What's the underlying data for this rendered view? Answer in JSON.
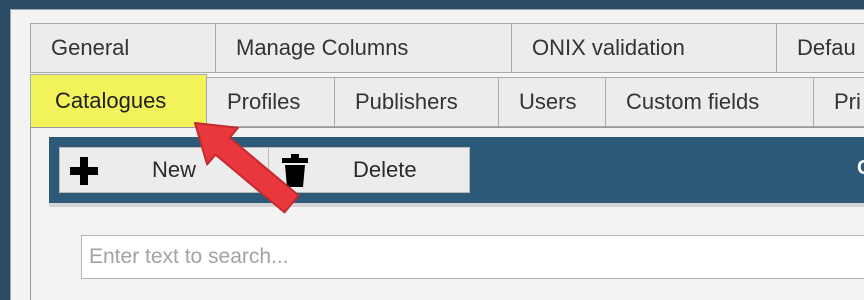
{
  "tabs_row1": [
    {
      "label": "General"
    },
    {
      "label": "Manage Columns"
    },
    {
      "label": "ONIX validation"
    },
    {
      "label": "Defau"
    }
  ],
  "tabs_row2": [
    {
      "label": "Catalogues",
      "active": true
    },
    {
      "label": "Profiles"
    },
    {
      "label": "Publishers"
    },
    {
      "label": "Users"
    },
    {
      "label": "Custom fields"
    },
    {
      "label": "Pri"
    }
  ],
  "toolbar": {
    "new_label": "New",
    "delete_label": "Delete",
    "edge_text": "C"
  },
  "search": {
    "placeholder": "Enter text to search..."
  },
  "icons": {
    "new": "plus-icon",
    "delete": "trash-icon",
    "annotation": "red-arrow-annotation"
  },
  "colors": {
    "active_tab_bg": "#f2f25a",
    "toolbar_bg": "#2e5a79",
    "arrow": "#e8383d",
    "frame": "#2b4a63"
  }
}
